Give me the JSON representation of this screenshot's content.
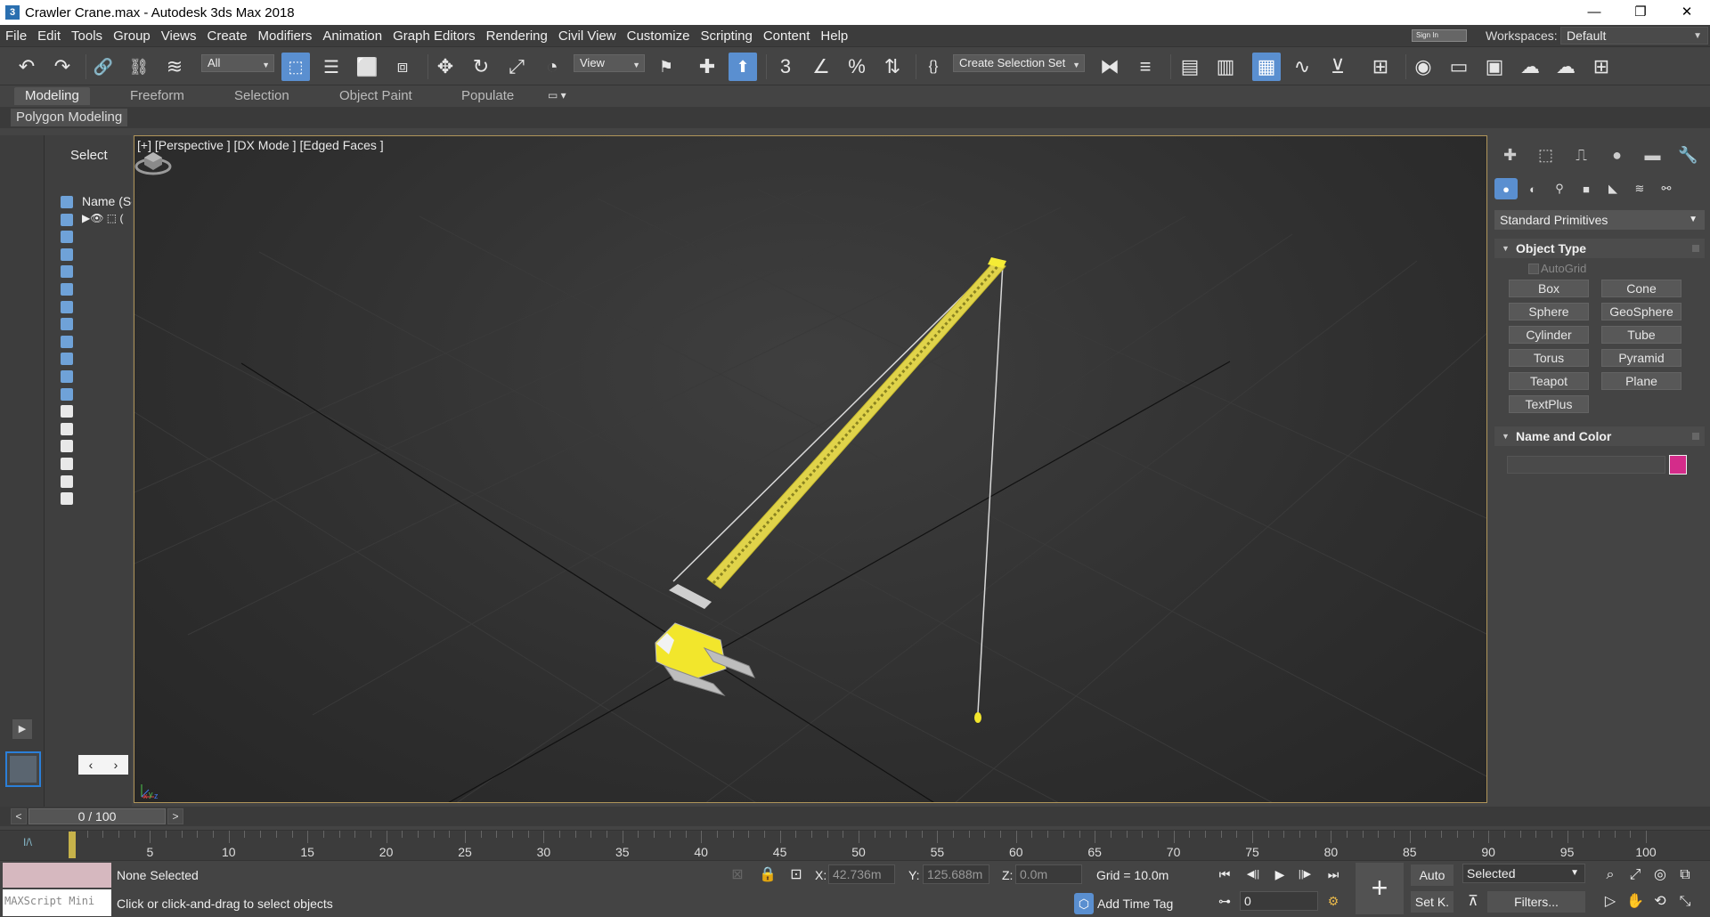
{
  "window": {
    "title": "Crawler Crane.max - Autodesk 3ds Max 2018",
    "app_icon": "3",
    "minimize": "—",
    "restore": "❐",
    "close": "✕"
  },
  "menu": [
    "File",
    "Edit",
    "Tools",
    "Group",
    "Views",
    "Create",
    "Modifiers",
    "Animation",
    "Graph Editors",
    "Rendering",
    "Civil View",
    "Customize",
    "Scripting",
    "Content",
    "Help"
  ],
  "signin": "Sign In",
  "workspaces": {
    "label": "Workspaces:",
    "value": "Default"
  },
  "toolbar": {
    "filter": "All",
    "ref_coord": "View",
    "selection_set": "Create Selection Set",
    "icons": {
      "undo": "↶",
      "redo": "↷",
      "link": "🔗",
      "unlink": "⛓",
      "bind": "≋",
      "select": "⬚",
      "select_by_name": "☰",
      "rect_region": "⬜",
      "window_crossing": "⧈",
      "move": "✥",
      "rotate": "↻",
      "scale": "⤢",
      "placement": "◔",
      "use_pivot": "⚑",
      "manipulate": "✚",
      "keyboard_shortcut": "⬆",
      "snap": "3",
      "angle_snap": "∠",
      "percent_snap": "%",
      "spinner_snap": "⇅",
      "edit_named_sets": "{}",
      "mirror": "⧓",
      "align": "≡",
      "layers": "▤",
      "ribbon_toggle": "▦",
      "scene_explorer": "▥",
      "curve_editor": "∿",
      "dope_sheet": "⊻",
      "schematic": "⊞",
      "material_editor": "◉",
      "render_setup": "▭",
      "render_frame": "▣",
      "render": "☁",
      "render_cloud": "☁",
      "a360": "⊞"
    }
  },
  "ribbon": {
    "tabs": [
      "Modeling",
      "Freeform",
      "Selection",
      "Object Paint",
      "Populate"
    ],
    "active_tab": "Modeling",
    "menu_icon": "▭ ▾",
    "subtab": "Polygon Modeling"
  },
  "explorer": {
    "select_label": "Select",
    "name_header": "Name (Sorted Ascending)",
    "row_icons": "▶👁 ⬚ (",
    "nav_prev": "‹",
    "nav_next": "›"
  },
  "viewport": {
    "label": "[+] [Perspective ] [DX Mode ] [Edged Faces ]",
    "axis_x": "x",
    "axis_y": "y",
    "axis_z": "z"
  },
  "command_panel": {
    "tab_icons": [
      "✚",
      "⬚",
      "⎍",
      "●",
      "▬",
      "🔧"
    ],
    "category_icons": [
      "●",
      "◐",
      "⚲",
      "■",
      "◣",
      "≋",
      "⚯"
    ],
    "category_dropdown": "Standard Primitives",
    "object_type_header": "Object Type",
    "autogrid": "AutoGrid",
    "primitives": [
      "Box",
      "Cone",
      "Sphere",
      "GeoSphere",
      "Cylinder",
      "Tube",
      "Torus",
      "Pyramid",
      "Teapot",
      "Plane",
      "TextPlus"
    ],
    "name_color_header": "Name and Color",
    "object_color": "#d42c8a"
  },
  "time": {
    "frame": "0 / 100",
    "prev": "<",
    "next": ">",
    "ticks": [
      "5",
      "10",
      "15",
      "20",
      "25",
      "30",
      "35",
      "40",
      "45",
      "50",
      "55",
      "60",
      "65",
      "70",
      "75",
      "80",
      "85",
      "90",
      "95",
      "100"
    ],
    "keys_icon": "I/\\"
  },
  "status": {
    "listener_text": "MAXScript Mini",
    "selection": "None Selected",
    "prompt": "Click or click-and-drag to select objects",
    "x_label": "X:",
    "x_value": "42.736m",
    "y_label": "Y:",
    "y_value": "125.688m",
    "z_label": "Z:",
    "z_value": "0.0m",
    "grid": "Grid = 10.0m",
    "time_tag": "Add Time Tag",
    "current_frame": "0",
    "auto_key": "Auto",
    "set_key": "Set K.",
    "key_filter_set": "Selected",
    "filters": "Filters...",
    "key_plus": "+",
    "playback": [
      "⏮",
      "◀||",
      "▶",
      "||▶",
      "⏭"
    ],
    "key_mode": "⊶",
    "nav_icons": [
      "⌕",
      "⤢",
      "◎",
      "⧉",
      "▷",
      "✋",
      "⟲",
      "⤡"
    ]
  }
}
